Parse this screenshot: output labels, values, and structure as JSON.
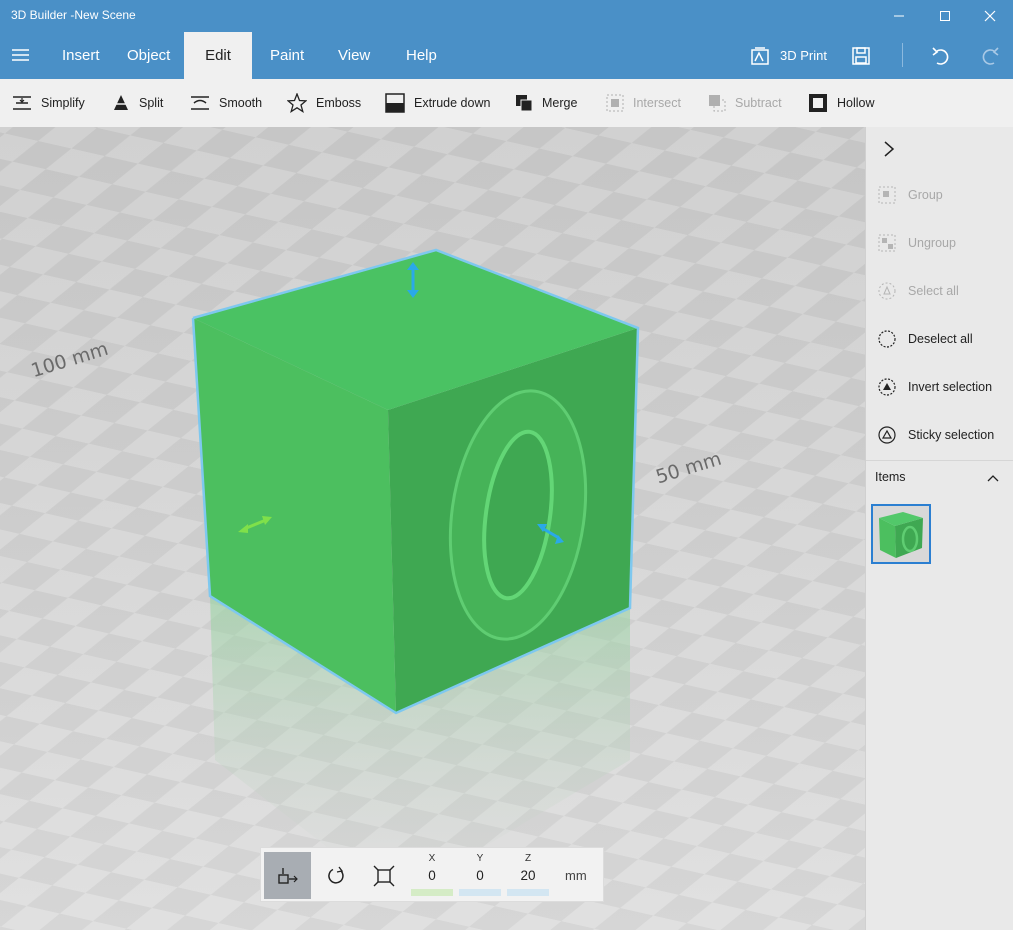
{
  "window": {
    "title": "3D Builder -New Scene",
    "controls": [
      "minimize-icon",
      "maximize-icon",
      "close-icon"
    ]
  },
  "menubar": {
    "items": [
      {
        "label": "Insert"
      },
      {
        "label": "Object"
      },
      {
        "label": "Edit",
        "active": true
      },
      {
        "label": "Paint"
      },
      {
        "label": "View"
      },
      {
        "label": "Help"
      }
    ],
    "print_label": "3D Print"
  },
  "toolbar": {
    "tools": [
      {
        "label": "Simplify",
        "icon": "simplify-icon",
        "enabled": true
      },
      {
        "label": "Split",
        "icon": "split-icon",
        "enabled": true
      },
      {
        "label": "Smooth",
        "icon": "smooth-icon",
        "enabled": true
      },
      {
        "label": "Emboss",
        "icon": "star-icon",
        "enabled": true
      },
      {
        "label": "Extrude down",
        "icon": "extrude-down-icon",
        "enabled": true
      },
      {
        "label": "Merge",
        "icon": "merge-icon",
        "enabled": true
      },
      {
        "label": "Intersect",
        "icon": "intersect-icon",
        "enabled": false
      },
      {
        "label": "Subtract",
        "icon": "subtract-icon",
        "enabled": false
      },
      {
        "label": "Hollow",
        "icon": "hollow-icon",
        "enabled": true
      }
    ]
  },
  "viewport": {
    "scale_labels": {
      "left": "100 mm",
      "right": "50 mm"
    },
    "object_color": "#4cc05f",
    "selection_color": "#7ec8ef"
  },
  "side_panel": {
    "actions": [
      {
        "label": "Group",
        "enabled": false
      },
      {
        "label": "Ungroup",
        "enabled": false
      },
      {
        "label": "Select all",
        "enabled": false
      },
      {
        "label": "Deselect all",
        "enabled": true
      },
      {
        "label": "Invert selection",
        "enabled": true
      },
      {
        "label": "Sticky selection",
        "enabled": true
      }
    ],
    "items_label": "Items"
  },
  "transform": {
    "x_label": "X",
    "x_value": "0",
    "y_label": "Y",
    "y_value": "0",
    "z_label": "Z",
    "z_value": "20",
    "unit": "mm"
  },
  "colors": {
    "accent": "#4a90c7",
    "selection_border": "#2b7fd1",
    "x_axis": "#7fe04a",
    "y_axis": "#2aa9e8"
  }
}
